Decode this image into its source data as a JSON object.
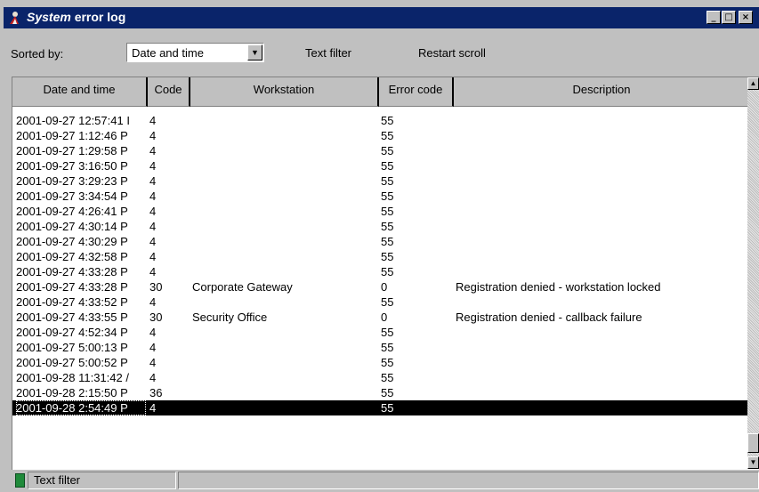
{
  "window": {
    "title_italic": "System",
    "title_rest": " error log"
  },
  "toolbar": {
    "sorted_by_label": "Sorted by:",
    "sort_select_value": "Date and time",
    "text_filter_label": "Text filter",
    "restart_scroll_label": "Restart scroll"
  },
  "table": {
    "columns": [
      "Date and time",
      "Code",
      "Workstation",
      "Error code",
      "Description"
    ],
    "rows": [
      [
        "2001-09-27 12:57:41 I",
        "4",
        "",
        "55",
        ""
      ],
      [
        "2001-09-27 1:12:46 P",
        "4",
        "",
        "55",
        ""
      ],
      [
        "2001-09-27 1:29:58 P",
        "4",
        "",
        "55",
        ""
      ],
      [
        "2001-09-27 3:16:50 P",
        "4",
        "",
        "55",
        ""
      ],
      [
        "2001-09-27 3:29:23 P",
        "4",
        "",
        "55",
        ""
      ],
      [
        "2001-09-27 3:34:54 P",
        "4",
        "",
        "55",
        ""
      ],
      [
        "2001-09-27 4:26:41 P",
        "4",
        "",
        "55",
        ""
      ],
      [
        "2001-09-27 4:30:14 P",
        "4",
        "",
        "55",
        ""
      ],
      [
        "2001-09-27 4:30:29 P",
        "4",
        "",
        "55",
        ""
      ],
      [
        "2001-09-27 4:32:58 P",
        "4",
        "",
        "55",
        ""
      ],
      [
        "2001-09-27 4:33:28 P",
        "4",
        "",
        "55",
        ""
      ],
      [
        "2001-09-27 4:33:28 P",
        "30",
        "Corporate Gateway",
        "0",
        "Registration denied - workstation locked"
      ],
      [
        "2001-09-27 4:33:52 P",
        "4",
        "",
        "55",
        ""
      ],
      [
        "2001-09-27 4:33:55 P",
        "30",
        "Security Office",
        "0",
        "Registration denied - callback failure"
      ],
      [
        "2001-09-27 4:52:34 P",
        "4",
        "",
        "55",
        ""
      ],
      [
        "2001-09-27 5:00:13 P",
        "4",
        "",
        "55",
        ""
      ],
      [
        "2001-09-27 5:00:52 P",
        "4",
        "",
        "55",
        ""
      ],
      [
        "2001-09-28 11:31:42 /",
        "4",
        "",
        "55",
        ""
      ],
      [
        "2001-09-28 2:15:50 P",
        "36",
        "",
        "55",
        ""
      ],
      [
        "2001-09-28 2:54:49 P",
        "4",
        "",
        "55",
        ""
      ]
    ],
    "selected_row": 19
  },
  "statusbar": {
    "text": "Text filter"
  },
  "colors": {
    "titlebar": "#0a246a",
    "face": "#c0c0c0",
    "status_led": "#1f8a3a",
    "selection": "#000000"
  },
  "icons": [
    "app-icon",
    "minimize-icon",
    "maximize-icon",
    "close-icon",
    "chevron-down-icon",
    "scroll-up-icon",
    "scroll-down-icon"
  ]
}
